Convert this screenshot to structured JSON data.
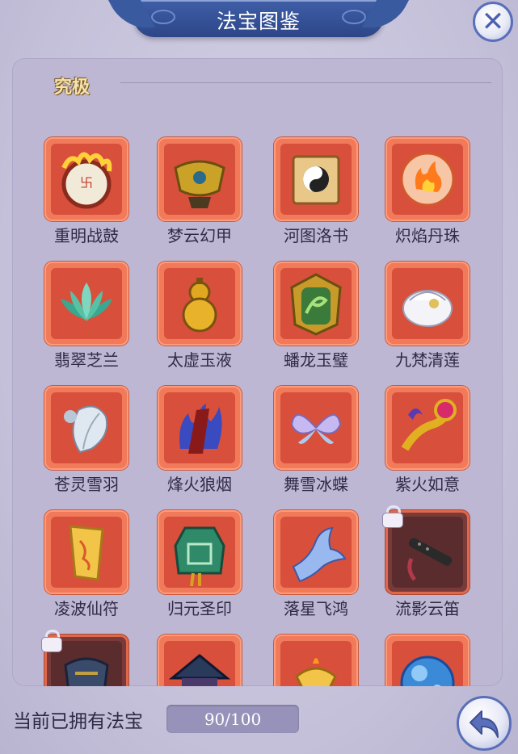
{
  "window": {
    "title": "法宝图鉴",
    "close_icon": "close-x-icon"
  },
  "tier": {
    "label": "究极"
  },
  "items": [
    {
      "name": "重明战鼓",
      "icon": "war-drum-icon",
      "locked": false
    },
    {
      "name": "梦云幻甲",
      "icon": "golden-armor-icon",
      "locked": false
    },
    {
      "name": "河图洛书",
      "icon": "taiji-scroll-icon",
      "locked": false
    },
    {
      "name": "炽焰丹珠",
      "icon": "flame-orb-icon",
      "locked": false
    },
    {
      "name": "翡翠芝兰",
      "icon": "jade-lotus-icon",
      "locked": false
    },
    {
      "name": "太虚玉液",
      "icon": "gourd-icon",
      "locked": false
    },
    {
      "name": "蟠龙玉璧",
      "icon": "dragon-jade-icon",
      "locked": false
    },
    {
      "name": "九梵清莲",
      "icon": "white-lotus-icon",
      "locked": false
    },
    {
      "name": "苍灵雪羽",
      "icon": "snow-feather-icon",
      "locked": false
    },
    {
      "name": "烽火狼烟",
      "icon": "smoke-flame-icon",
      "locked": false
    },
    {
      "name": "舞雪冰蝶",
      "icon": "ice-butterfly-icon",
      "locked": false
    },
    {
      "name": "紫火如意",
      "icon": "ruyi-icon",
      "locked": false
    },
    {
      "name": "凌波仙符",
      "icon": "talisman-icon",
      "locked": false
    },
    {
      "name": "归元圣印",
      "icon": "jade-seal-icon",
      "locked": false
    },
    {
      "name": "落星飞鸿",
      "icon": "phoenix-bird-icon",
      "locked": false
    },
    {
      "name": "流影云笛",
      "icon": "flute-icon",
      "locked": true
    },
    {
      "name": "",
      "icon": "dark-armor-icon",
      "locked": true
    },
    {
      "name": "",
      "icon": "dark-roof-icon",
      "locked": false
    },
    {
      "name": "",
      "icon": "golden-lamp-icon",
      "locked": false
    },
    {
      "name": "",
      "icon": "blue-orb-icon",
      "locked": false
    }
  ],
  "footer": {
    "owned_label": "当前已拥有法宝",
    "owned_count": "90/100",
    "owned_fraction": 0.9,
    "back_icon": "return-arrow-icon"
  },
  "colors": {
    "title_bar": "#3a5aa0",
    "card_frame": "#f07a5a",
    "panel": "#bdb7d4",
    "tier_label": "#f6e3a8"
  }
}
